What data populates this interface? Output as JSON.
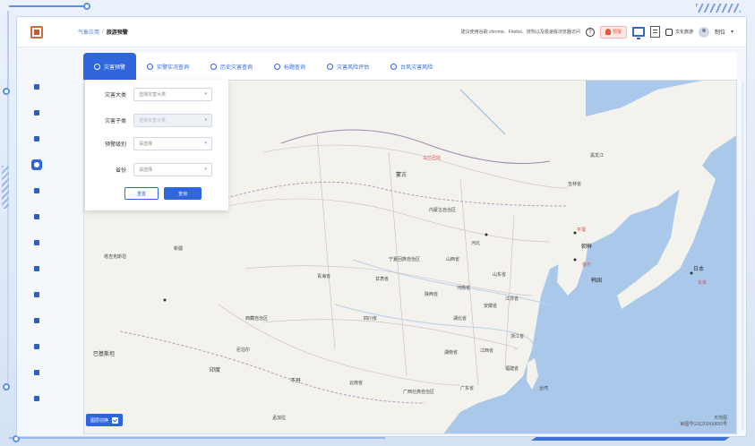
{
  "header": {
    "breadcrumb_parent": "气象应用",
    "breadcrumb_sep": "/",
    "breadcrumb_current": "旅游预警",
    "browser_tip": "建议使用谷歌 chrome、Firefox、搜狗以及极速版浏览器访问",
    "help_icon": "?",
    "alert_label": "预警",
    "user_group_label": "文化旅游",
    "user_name": "制位",
    "caret": "▾"
  },
  "tabs": [
    {
      "label": "灾害预警",
      "active": true
    },
    {
      "label": "实警实况查询",
      "active": false
    },
    {
      "label": "历史灾害查询",
      "active": false
    },
    {
      "label": "标题查询",
      "active": false
    },
    {
      "label": "灾害风险评估",
      "active": false
    },
    {
      "label": "台风灾害风险",
      "active": false
    }
  ],
  "query_panel": {
    "field1_label": "灾害大类",
    "field1_placeholder": "选择灾害大类",
    "field2_label": "灾害子类",
    "field2_placeholder": "选择灾害子类",
    "field3_label": "预警级别",
    "field3_placeholder": "请选择",
    "field4_label": "省份",
    "field4_placeholder": "请选择",
    "reset_label": "重置",
    "query_label": "查询",
    "arrow": "▾"
  },
  "map": {
    "labels": {
      "mongolia": "蒙古",
      "korea_n": "朝鲜",
      "korea_s": "韩国",
      "japan": "日本",
      "pakistan": "巴基斯坦",
      "india": "印度",
      "nepal": "尼泊尔",
      "bhutan": "不丹",
      "bangladesh": "孟加拉",
      "tajik": "塔吉克斯坦",
      "inner_mongolia": "内蒙古自治区",
      "xinjiang": "新疆",
      "tibet": "西藏自治区",
      "qinghai": "青海省",
      "gansu": "甘肃省",
      "sichuan": "四川省",
      "hebei": "河北",
      "shanxi": "山西省",
      "shaanxi": "陕西省",
      "henan": "河南省",
      "shandong": "山东省",
      "hubei": "湖北省",
      "anhui": "安徽省",
      "jiangsu": "江苏省",
      "zhejiang": "浙江省",
      "jiangxi": "江西省",
      "hunan": "湖南省",
      "yunnan": "云南省",
      "guangxi": "广西壮族自治区",
      "guangdong": "广东省",
      "fujian": "福建省",
      "taiwan": "台湾",
      "ningxia": "宁夏回族自治区",
      "jilin": "吉林省",
      "heilongjiang": "黑龙江",
      "ulaanbaatar": "乌兰巴托",
      "pyongyang": "平壤",
      "seoul": "首尔",
      "tokyo": "东京"
    },
    "credit_line1": "天地图",
    "credit_line2": "审图号GS(2024)0650号",
    "layer_toggle_label": "图层切换"
  },
  "sidebar": {
    "items": [
      "home-icon",
      "shield-icon",
      "list-icon",
      "map-pin-icon",
      "doc-icon",
      "chart-icon",
      "alert-icon",
      "settings-icon",
      "location-icon",
      "weather-icon",
      "folder-icon",
      "user-icon",
      "filter-icon"
    ],
    "active_index": 3
  }
}
